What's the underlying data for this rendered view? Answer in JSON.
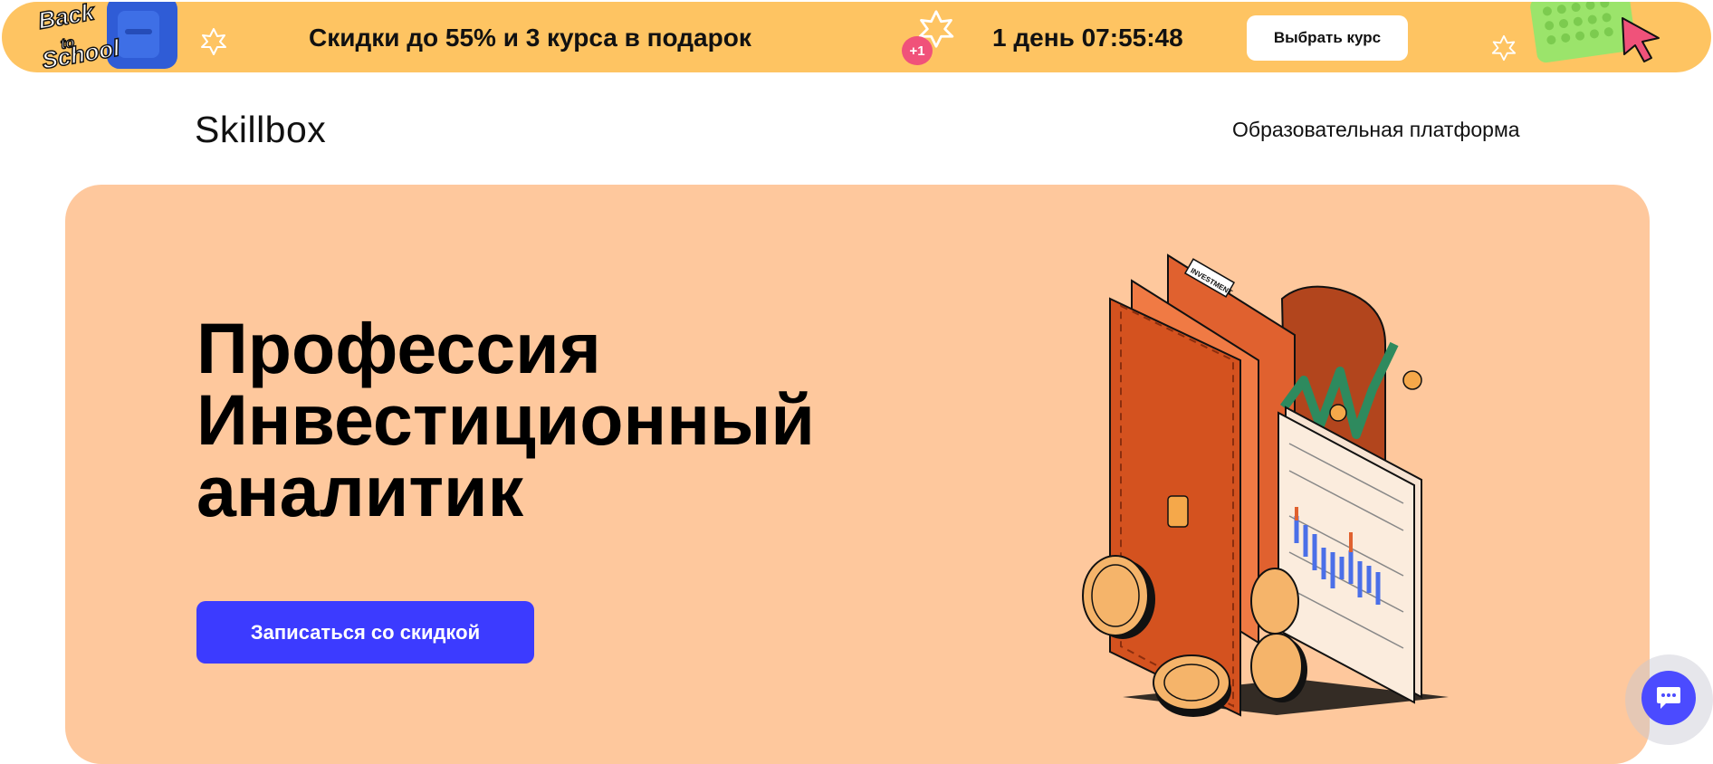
{
  "promo": {
    "badge_text": "Back to School",
    "headline": "Скидки до 55% и 3 курса в подарок",
    "plus_badge": "+1",
    "countdown": "1 день 07:55:48",
    "choose_button": "Выбрать курс",
    "background_color": "#FEC462"
  },
  "header": {
    "logo": "Skillbox",
    "platform_link": "Образовательная платформа"
  },
  "hero": {
    "title_lines": [
      "Профессия",
      "Инвестиционный",
      "аналитик"
    ],
    "cta_label": "Записаться со скидкой",
    "illustration_tag": "INVESTMENT",
    "background_color": "#FEC89D",
    "accent_color": "#3C3BFF"
  },
  "chat": {
    "icon": "chat-icon"
  }
}
